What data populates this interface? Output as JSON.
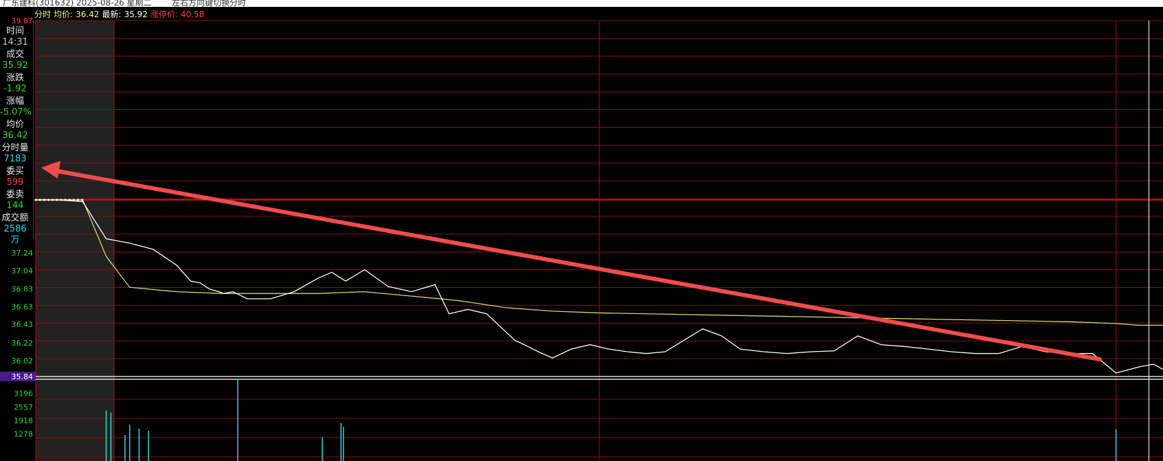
{
  "window": {
    "title_fragment": "广东建科(301632) 2025-08-26 星期二",
    "subtitle_fragment": "左右方向键切换分时"
  },
  "header": {
    "mode_label": "分时",
    "avg_label": "均价:",
    "avg_value": "36.42",
    "last_label": "最新:",
    "last_value": "35.92",
    "limit_up_label": "涨停价:",
    "limit_up_value": "40.58"
  },
  "info_panel": {
    "items": [
      {
        "label": "时间",
        "value": "14:31",
        "color": "#c8c8c8"
      },
      {
        "label": "成交",
        "value": "35.92",
        "color": "#2fd82f"
      },
      {
        "label": "涨跌",
        "value": "-1.92",
        "color": "#2fd82f"
      },
      {
        "label": "涨幅",
        "value": "-5.07%",
        "color": "#2fd82f"
      },
      {
        "label": "均价",
        "value": "36.42",
        "color": "#2fd82f"
      },
      {
        "label": "分时量",
        "value": "7183",
        "color": "#33d6e6"
      },
      {
        "label": "委买",
        "value": "599",
        "color": "#ff4040"
      },
      {
        "label": "委卖",
        "value": "144",
        "color": "#2fd82f"
      },
      {
        "label": "成交额",
        "value": "2586万",
        "color": "#33d6e6"
      }
    ]
  },
  "colors": {
    "grid": "#8a1010",
    "price_line": "#ffffff",
    "avg_line": "#d8d860",
    "axis_down": "#2fd82f",
    "axis_up": "#ff4040",
    "volume_bar": "#33d6e6",
    "annotation_arrow": "#ef4c4c",
    "current_price_bg": "#4a1a8c"
  },
  "chart_data": {
    "type": "line",
    "price_axis_top_label": "39.87",
    "price_ticks": [
      "37.24",
      "37.04",
      "36.83",
      "36.63",
      "36.43",
      "36.22",
      "36.02"
    ],
    "current_price_label": "35.84",
    "ylim": [
      35.84,
      39.87
    ],
    "prev_close": 37.84,
    "x_range": [
      0,
      240
    ],
    "series": [
      {
        "key": "price",
        "x": [
          0,
          5,
          10,
          15,
          20,
          25,
          30,
          33,
          35,
          37,
          39,
          40,
          42,
          45,
          50,
          55,
          60,
          63,
          66,
          70,
          75,
          80,
          85,
          88,
          92,
          96,
          100,
          102,
          104,
          107,
          110,
          114,
          118,
          122,
          126,
          130,
          134,
          138,
          142,
          146,
          150,
          155,
          160,
          165,
          170,
          175,
          180,
          185,
          190,
          195,
          200,
          205,
          210,
          215,
          220,
          225,
          230,
          235,
          238,
          240
        ],
        "y": [
          37.84,
          37.84,
          37.82,
          37.4,
          37.35,
          37.28,
          37.1,
          36.92,
          36.9,
          36.83,
          36.8,
          36.78,
          36.8,
          36.72,
          36.72,
          36.8,
          36.95,
          37.02,
          36.92,
          37.05,
          36.86,
          36.8,
          36.88,
          36.55,
          36.6,
          36.55,
          36.35,
          36.25,
          36.2,
          36.12,
          36.05,
          36.15,
          36.2,
          36.15,
          36.12,
          36.1,
          36.12,
          36.25,
          36.38,
          36.3,
          36.15,
          36.12,
          36.1,
          36.12,
          36.13,
          36.3,
          36.2,
          36.18,
          36.15,
          36.12,
          36.1,
          36.1,
          36.18,
          36.12,
          36.1,
          36.1,
          35.88,
          35.95,
          35.98,
          35.92
        ]
      },
      {
        "key": "average",
        "x": [
          0,
          10,
          15,
          20,
          30,
          40,
          50,
          60,
          70,
          80,
          90,
          100,
          110,
          120,
          140,
          160,
          180,
          200,
          220,
          230,
          235,
          240
        ],
        "y": [
          37.84,
          37.84,
          37.2,
          36.85,
          36.8,
          36.78,
          36.78,
          36.78,
          36.8,
          36.75,
          36.7,
          36.62,
          36.58,
          36.56,
          36.54,
          36.52,
          36.5,
          36.48,
          36.46,
          36.44,
          36.42,
          36.42
        ]
      }
    ],
    "volume": {
      "ticks": [
        "3196",
        "2557",
        "1918",
        "1278"
      ],
      "ylim": [
        0,
        3834
      ],
      "x": [
        15,
        16,
        19,
        20,
        22,
        24,
        43,
        61,
        65,
        65.5,
        230
      ],
      "values": [
        2380,
        2290,
        1230,
        1720,
        1520,
        1430,
        3840,
        1130,
        1800,
        1620,
        1500
      ]
    },
    "crosshair_x": 237
  },
  "annotation": {
    "type": "arrow"
  }
}
